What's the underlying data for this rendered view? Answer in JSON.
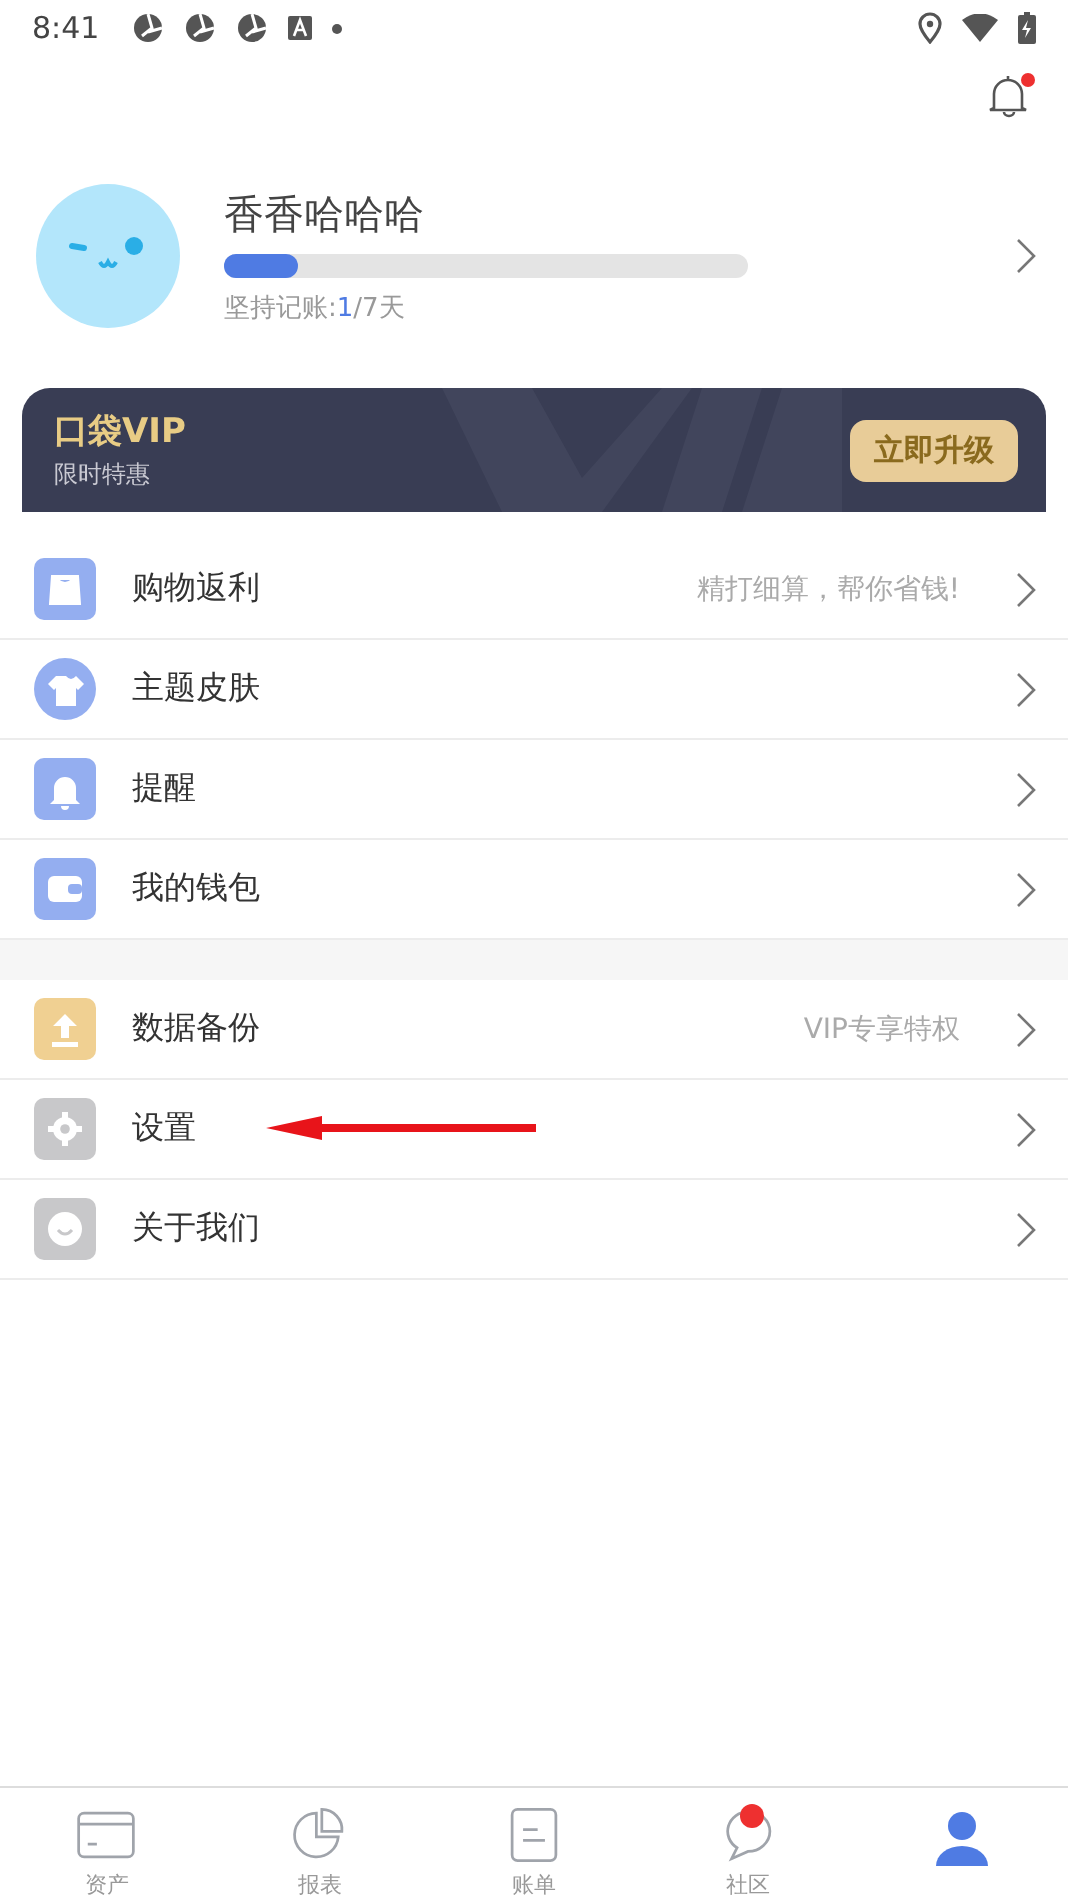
{
  "status_bar": {
    "time": "8:41"
  },
  "header": {
    "bell_badge": true
  },
  "profile": {
    "name": "香香哈哈哈",
    "level": 0.14,
    "streak_label": "坚持记账:",
    "streak_current": "1",
    "streak_total": "/7天"
  },
  "vip": {
    "title": "口袋VIP",
    "subtitle": "限时特惠",
    "button": "立即升级"
  },
  "menu_groups": [
    [
      {
        "kind": "bag",
        "label": "购物返利",
        "hint": "精打细算，帮你省钱!"
      },
      {
        "kind": "shirt",
        "label": "主题皮肤"
      },
      {
        "kind": "bell",
        "label": "提醒"
      },
      {
        "kind": "wallet",
        "label": "我的钱包"
      }
    ],
    [
      {
        "kind": "upload",
        "label": "数据备份",
        "hint": "VIP专享特权"
      },
      {
        "kind": "gear",
        "label": "设置",
        "annotated": true
      },
      {
        "kind": "smile",
        "label": "关于我们"
      }
    ]
  ],
  "tab_bar": [
    {
      "kind": "card",
      "label": "资产",
      "selected": false
    },
    {
      "kind": "pie",
      "label": "报表",
      "selected": false
    },
    {
      "kind": "bill",
      "label": "账单",
      "selected": false
    },
    {
      "kind": "chat",
      "label": "社区",
      "selected": false,
      "badge": true
    },
    {
      "kind": "person",
      "selected": true
    }
  ]
}
